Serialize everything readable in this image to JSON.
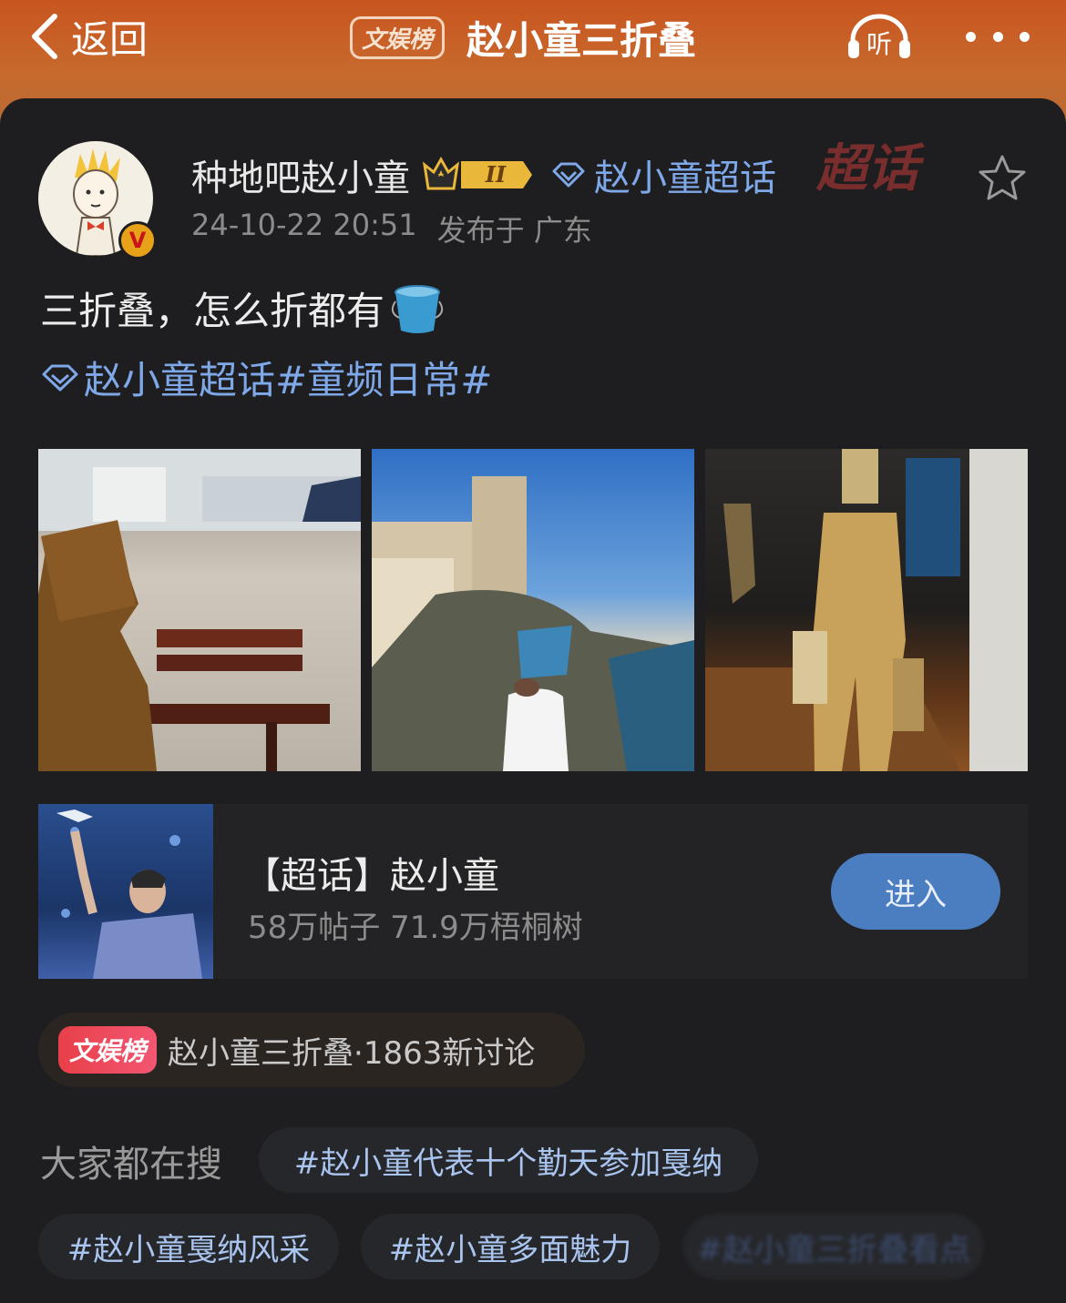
{
  "header": {
    "back_label": "返回",
    "hot_tag": "文娱榜",
    "title": "赵小童三折叠",
    "listen_label": "听"
  },
  "post": {
    "author": "种地吧赵小童",
    "rank_badge": "II",
    "super_topic": "赵小童超话",
    "watermark": "超话",
    "date": "24-10-22 20:51",
    "location": "发布于 广东",
    "text": "三折叠，怎么折都有",
    "tags_text": "赵小童超话#童频日常#"
  },
  "topic_card": {
    "title": "【超话】赵小童",
    "stats": "58万帖子 71.9万梧桐树",
    "enter_label": "进入"
  },
  "hot": {
    "badge": "文娱榜",
    "text": "赵小童三折叠·1863新讨论"
  },
  "search": {
    "label": "大家都在搜",
    "chips": [
      "#赵小童代表十个勤天参加戛纳",
      "#赵小童戛纳风采",
      "#赵小童多面魅力",
      "#赵小童三折叠看点"
    ]
  },
  "colors": {
    "header_orange": "#c8551f",
    "link_blue": "#7ea8e8",
    "button_blue": "#4b7dc1",
    "hot_red": "#e8404a"
  }
}
